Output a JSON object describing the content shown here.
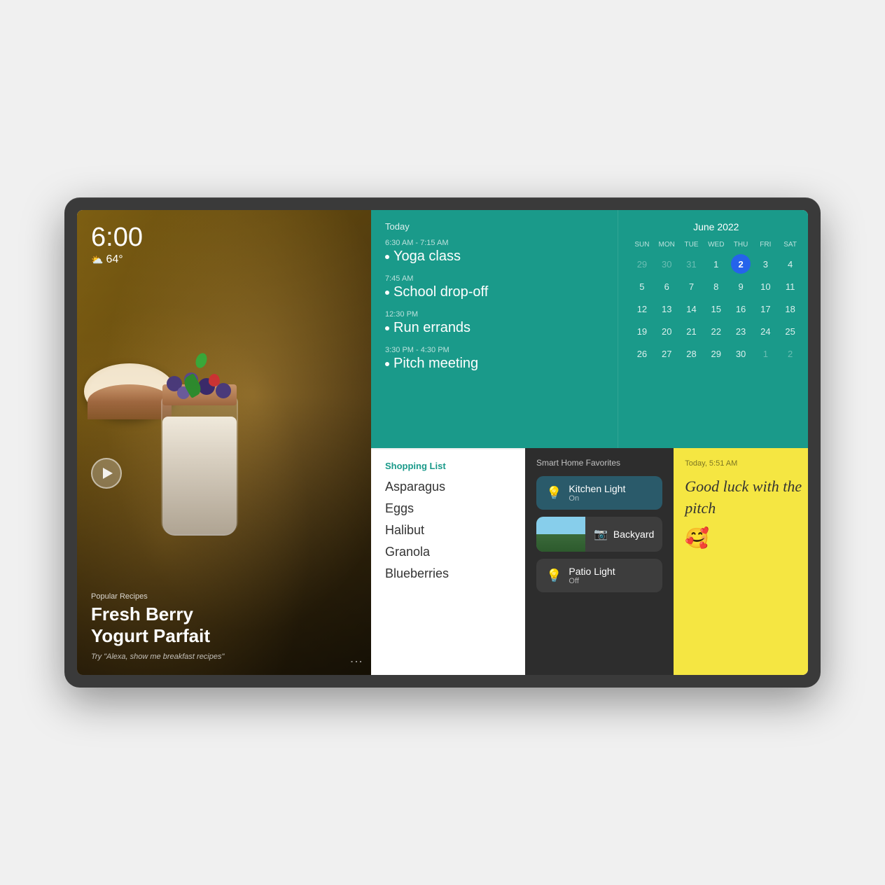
{
  "device": {
    "border_color": "#3a3a3a"
  },
  "hero": {
    "time": "6:00",
    "weather": "64°",
    "weather_icon": "⛅",
    "recipe_label": "Popular Recipes",
    "recipe_title": "Fresh Berry\nYogurt Parfait",
    "recipe_hint": "Try \"Alexa, show me breakfast recipes\""
  },
  "schedule": {
    "panel_title": "Today",
    "events": [
      {
        "time": "6:30 AM - 7:15 AM",
        "name": "Yoga class"
      },
      {
        "time": "7:45 AM",
        "name": "School drop-off"
      },
      {
        "time": "12:30 PM",
        "name": "Run errands"
      },
      {
        "time": "3:30 PM - 4:30 PM",
        "name": "Pitch meeting"
      }
    ]
  },
  "calendar": {
    "month": "June 2022",
    "days_of_week": [
      "SUN",
      "MON",
      "TUE",
      "WED",
      "THU",
      "FRI",
      "SAT"
    ],
    "rows": [
      [
        "29",
        "30",
        "31",
        "1",
        "2",
        "3",
        "4"
      ],
      [
        "5",
        "6",
        "7",
        "8",
        "9",
        "10",
        "11"
      ],
      [
        "12",
        "13",
        "14",
        "15",
        "16",
        "17",
        "18"
      ],
      [
        "19",
        "20",
        "21",
        "22",
        "23",
        "24",
        "25"
      ],
      [
        "26",
        "27",
        "28",
        "29",
        "30",
        "1",
        "2"
      ]
    ],
    "today_index": "2",
    "today_row": 0,
    "today_col": 4
  },
  "shopping": {
    "title": "Shopping List",
    "items": [
      "Asparagus",
      "Eggs",
      "Halibut",
      "Granola",
      "Blueberries"
    ]
  },
  "smarthome": {
    "title": "Smart Home Favorites",
    "devices": [
      {
        "name": "Kitchen Light",
        "status": "On",
        "icon": "💡",
        "on": true
      },
      {
        "name": "Backyard",
        "status": "",
        "icon": "📷",
        "type": "camera"
      },
      {
        "name": "Patio Light",
        "status": "Off",
        "icon": "💡",
        "on": false
      }
    ]
  },
  "note": {
    "timestamp": "Today, 5:51 AM",
    "text": "Good luck with the pitch",
    "emoji": "🥰"
  }
}
